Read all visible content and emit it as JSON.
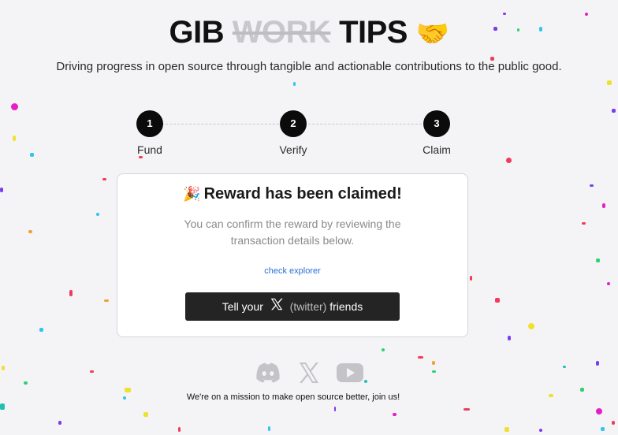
{
  "header": {
    "title_start": "GIB",
    "title_strike": "WORK",
    "title_end": "TIPS",
    "title_emoji": "🤝",
    "subtitle": "Driving progress in open source through tangible and actionable contributions to the public good."
  },
  "stepper": {
    "steps": [
      {
        "number": "1",
        "label": "Fund"
      },
      {
        "number": "2",
        "label": "Verify"
      },
      {
        "number": "3",
        "label": "Claim"
      }
    ]
  },
  "card": {
    "title_emoji": "🎉",
    "title": "Reward has been claimed!",
    "description": "You can confirm the reward by reviewing the transaction details below.",
    "explorer_link": "check explorer",
    "share_button": {
      "prefix": "Tell your",
      "muted": "(twitter)",
      "suffix": "friends"
    }
  },
  "footer": {
    "icons": [
      "discord-icon",
      "x-icon",
      "youtube-icon"
    ],
    "mission_text": "We're on a mission to make open source better, join us!"
  },
  "colors": {
    "background": "#f4f4f6",
    "step_dot": "#0b0b0b",
    "button": "#242424",
    "link": "#2b6fd6",
    "icon_gray": "#c4c4c8"
  },
  "confetti_colors": [
    "#e61ec8",
    "#f0e130",
    "#2ec4f0",
    "#7a3cf0",
    "#f03c5a",
    "#30d070",
    "#8a5cf0",
    "#f0a030",
    "#20c0b0"
  ]
}
